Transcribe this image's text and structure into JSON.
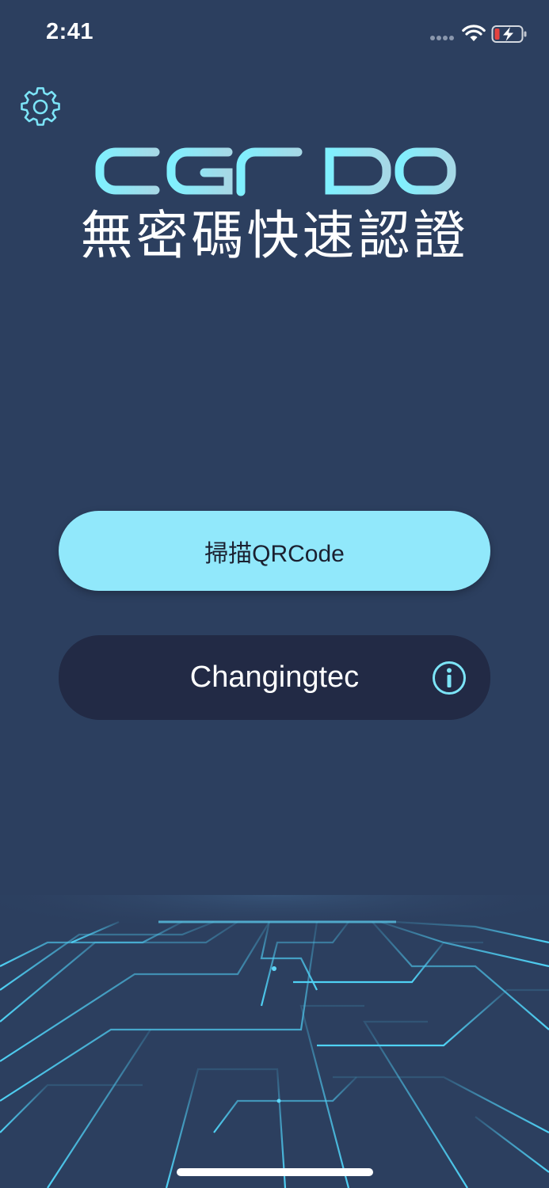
{
  "status_bar": {
    "time": "2:41"
  },
  "header": {
    "logo_text": "CGFIDO",
    "subtitle": "無密碼快速認證"
  },
  "buttons": {
    "scan_label": "掃描QRCode",
    "account_label": "Changingtec"
  },
  "colors": {
    "background": "#2c3f5f",
    "accent": "#91e8fb",
    "dark_button": "#222a45",
    "logo_gradient_start": "#7ff0ff",
    "logo_gradient_end": "#a6d8e6"
  },
  "icons": {
    "settings": "gear-icon",
    "info": "info-icon",
    "wifi": "wifi-icon",
    "battery": "battery-charging-icon",
    "signal": "signal-dots-icon"
  }
}
